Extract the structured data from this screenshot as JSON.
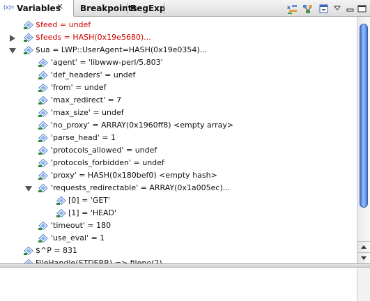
{
  "tabs": {
    "variables": {
      "label": "Variables",
      "icon": "variables-icon"
    },
    "breakpoints": {
      "label": "Breakpoints"
    },
    "regexp": {
      "label": "RegExp"
    }
  },
  "toolbar": {
    "buttons": [
      "show-type-names-icon",
      "show-logical-structure-icon",
      "collapse-all-icon",
      "view-menu-icon",
      "minimize-icon",
      "maximize-icon"
    ]
  },
  "colors": {
    "changed_value": "#d00000",
    "selection_accent": "#3d6fcd"
  },
  "tree": {
    "rows": [
      {
        "label": "$feed = undef",
        "changed": true,
        "expander": "none"
      },
      {
        "label": "$feeds = HASH(0x19e5680)...",
        "changed": true,
        "expander": "collapsed"
      },
      {
        "label": "$ua = LWP::UserAgent=HASH(0x19e0354)...",
        "changed": false,
        "expander": "expanded"
      },
      {
        "label": "'agent' = 'libwww-perl/5.803'",
        "changed": false,
        "expander": "none"
      },
      {
        "label": "'def_headers' = undef",
        "changed": false,
        "expander": "none"
      },
      {
        "label": "'from' = undef",
        "changed": false,
        "expander": "none"
      },
      {
        "label": "'max_redirect' = 7",
        "changed": false,
        "expander": "none"
      },
      {
        "label": "'max_size' = undef",
        "changed": false,
        "expander": "none"
      },
      {
        "label": "'no_proxy' = ARRAY(0x1960ff8) <empty array>",
        "changed": false,
        "expander": "none"
      },
      {
        "label": "'parse_head' = 1",
        "changed": false,
        "expander": "none"
      },
      {
        "label": "'protocols_allowed' = undef",
        "changed": false,
        "expander": "none"
      },
      {
        "label": "'protocols_forbidden' = undef",
        "changed": false,
        "expander": "none"
      },
      {
        "label": "'proxy' = HASH(0x180bef0) <empty hash>",
        "changed": false,
        "expander": "none"
      },
      {
        "label": "'requests_redirectable' = ARRAY(0x1a005ec)...",
        "changed": false,
        "expander": "expanded"
      },
      {
        "label": "[0] = 'GET'",
        "changed": false,
        "expander": "none"
      },
      {
        "label": "[1] = 'HEAD'",
        "changed": false,
        "expander": "none"
      },
      {
        "label": "'timeout' = 180",
        "changed": false,
        "expander": "none"
      },
      {
        "label": "'use_eval' = 1",
        "changed": false,
        "expander": "none"
      },
      {
        "label": "$^P = 831",
        "changed": false,
        "expander": "none"
      },
      {
        "label": "FileHandle(STDERR) => fileno(2)",
        "changed": false,
        "expander": "none"
      }
    ]
  }
}
